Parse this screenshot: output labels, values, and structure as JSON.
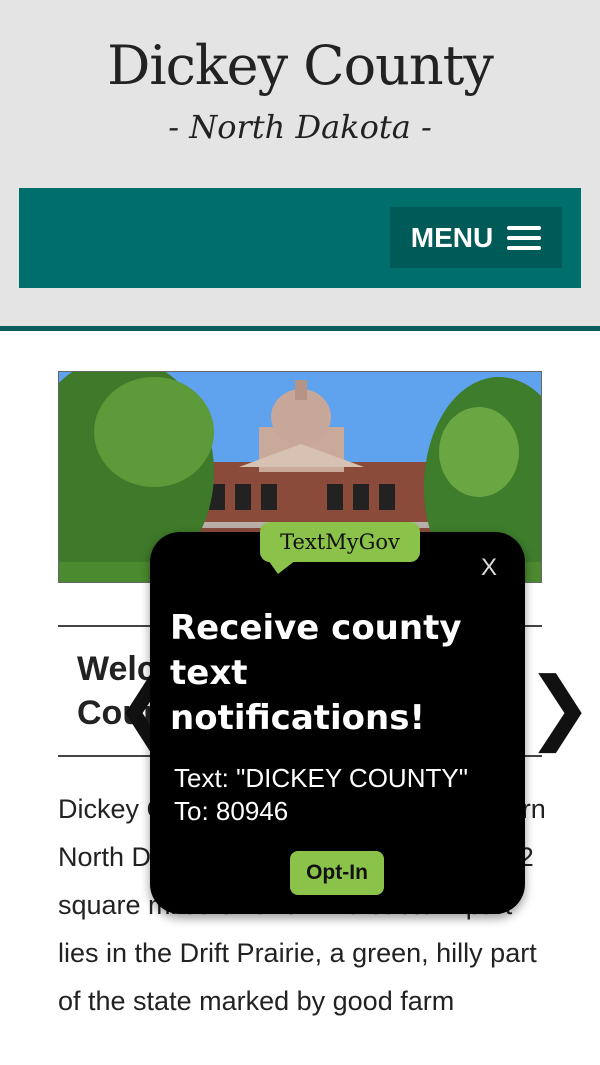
{
  "header": {
    "title": "Dickey County",
    "subtitle": "- North Dakota -"
  },
  "nav": {
    "menu_label": "MENU",
    "menu_icon": "hamburger-icon",
    "color": "#006e6a"
  },
  "main": {
    "welcome": "Welcome to Dickey County, North Dakota",
    "prev_arrow": "❮",
    "next_arrow": "❯",
    "intro_text": "Dickey County is located in southeastern North Dakota and is comprised of 1,142 square miles of land. The eastern part lies in the Drift Prairie, a green, hilly part of the state marked by good farm"
  },
  "popup": {
    "badge": "TextMyGov",
    "close_label": "X",
    "heading": "Receive county text notifications!",
    "sms_text": "Text: \"DICKEY COUNTY\" To: 80946",
    "optin_label": "Opt-In",
    "accent_color": "#8bc34a"
  }
}
